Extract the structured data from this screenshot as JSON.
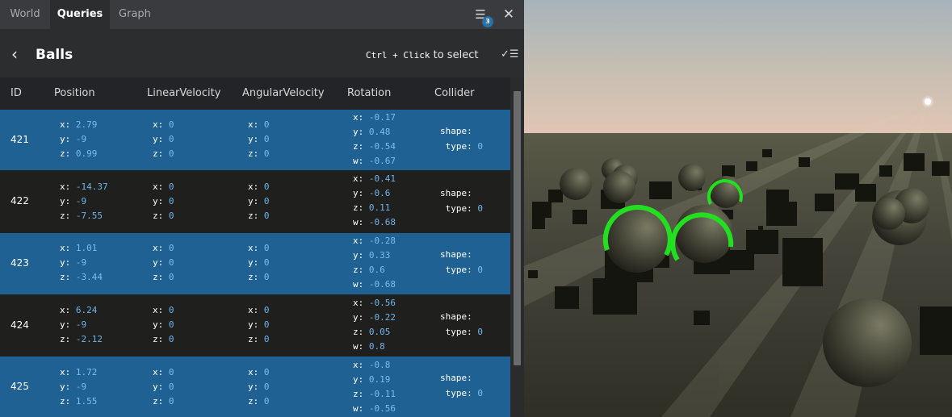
{
  "tabs": [
    {
      "label": "World",
      "active": false
    },
    {
      "label": "Queries",
      "active": true
    },
    {
      "label": "Graph",
      "active": false
    }
  ],
  "tab_icons": {
    "list_icon": "list-icon",
    "list_badge": "3",
    "close_icon": "close-icon"
  },
  "header": {
    "back_icon": "chevron-left-icon",
    "title": "Balls",
    "hint_kbd": "Ctrl + Click",
    "hint_text": "to select",
    "select_icon": "checklist-icon"
  },
  "columns": [
    "ID",
    "Position",
    "LinearVelocity",
    "AngularVelocity",
    "Rotation",
    "Collider"
  ],
  "rows": [
    {
      "id": "421",
      "position": {
        "x": "2.79",
        "y": "-9",
        "z": "0.99"
      },
      "linear": {
        "x": "0",
        "y": "0",
        "z": "0"
      },
      "angular": {
        "x": "0",
        "y": "0",
        "z": "0"
      },
      "rotation": {
        "x": "-0.17",
        "y": "0.48",
        "z": "-0.54",
        "w": "-0.67"
      },
      "collider": {
        "shape_label": "shape:",
        "type_label": "type:",
        "type": "0"
      }
    },
    {
      "id": "422",
      "position": {
        "x": "-14.37",
        "y": "-9",
        "z": "-7.55"
      },
      "linear": {
        "x": "0",
        "y": "0",
        "z": "0"
      },
      "angular": {
        "x": "0",
        "y": "0",
        "z": "0"
      },
      "rotation": {
        "x": "-0.41",
        "y": "-0.6",
        "z": "0.11",
        "w": "-0.68"
      },
      "collider": {
        "shape_label": "shape:",
        "type_label": "type:",
        "type": "0"
      }
    },
    {
      "id": "423",
      "position": {
        "x": "1.01",
        "y": "-9",
        "z": "-3.44"
      },
      "linear": {
        "x": "0",
        "y": "0",
        "z": "0"
      },
      "angular": {
        "x": "0",
        "y": "0",
        "z": "0"
      },
      "rotation": {
        "x": "-0.28",
        "y": "0.33",
        "z": "0.6",
        "w": "-0.68"
      },
      "collider": {
        "shape_label": "shape:",
        "type_label": "type:",
        "type": "0"
      }
    },
    {
      "id": "424",
      "position": {
        "x": "6.24",
        "y": "-9",
        "z": "-2.12"
      },
      "linear": {
        "x": "0",
        "y": "0",
        "z": "0"
      },
      "angular": {
        "x": "0",
        "y": "0",
        "z": "0"
      },
      "rotation": {
        "x": "-0.56",
        "y": "-0.22",
        "z": "0.05",
        "w": "0.8"
      },
      "collider": {
        "shape_label": "shape:",
        "type_label": "type:",
        "type": "0"
      }
    },
    {
      "id": "425",
      "position": {
        "x": "1.72",
        "y": "-9",
        "z": "1.55"
      },
      "linear": {
        "x": "0",
        "y": "0",
        "z": "0"
      },
      "angular": {
        "x": "0",
        "y": "0",
        "z": "0"
      },
      "rotation": {
        "x": "-0.8",
        "y": "0.19",
        "z": "-0.11",
        "w": "-0.56"
      },
      "collider": {
        "shape_label": "shape:",
        "type_label": "type:",
        "type": "0"
      }
    }
  ],
  "colors": {
    "selected_row": "#1f6192",
    "value_text": "#79bdf2",
    "highlight_ring": "#22e01f"
  }
}
